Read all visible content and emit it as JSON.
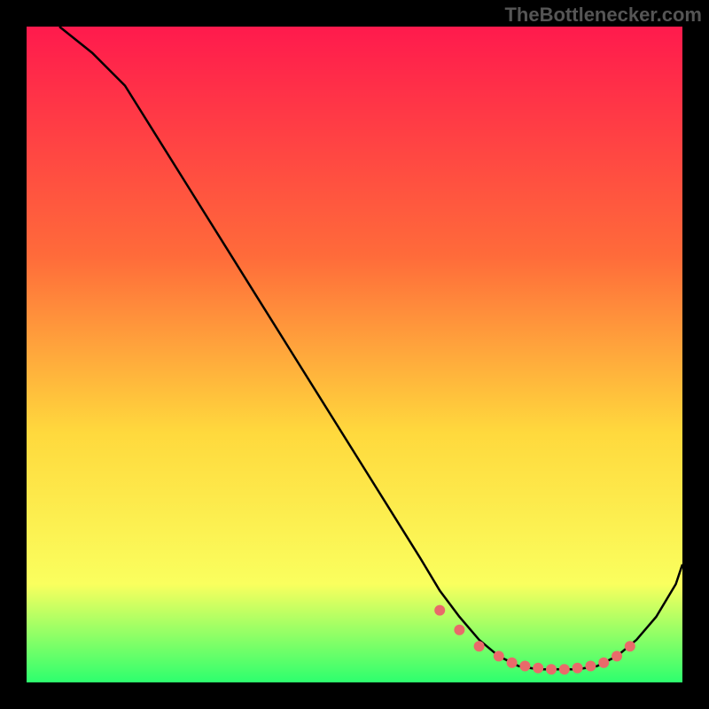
{
  "attribution": "TheBottlenecker.com",
  "chart_data": {
    "type": "line",
    "title": "",
    "xlabel": "",
    "ylabel": "",
    "xlim": [
      0,
      100
    ],
    "ylim": [
      0,
      100
    ],
    "gradient": {
      "top": "#ff1a4d",
      "mid_upper": "#ff6b3a",
      "mid": "#ffd93d",
      "mid_lower": "#faff5e",
      "bottom": "#2dff6e"
    },
    "series": [
      {
        "name": "curve",
        "x": [
          5,
          10,
          15,
          20,
          25,
          30,
          35,
          40,
          45,
          50,
          55,
          60,
          63,
          66,
          69,
          72,
          75,
          78,
          81,
          84,
          87,
          90,
          93,
          96,
          99,
          100
        ],
        "y": [
          100,
          96,
          91,
          83,
          75,
          67,
          59,
          51,
          43,
          35,
          27,
          19,
          14,
          10,
          6.5,
          4,
          2.5,
          2,
          2,
          2,
          2.5,
          4,
          6.5,
          10,
          15,
          18
        ]
      }
    ],
    "markers": {
      "name": "dotted-green-band",
      "x": [
        63,
        66,
        69,
        72,
        74,
        76,
        78,
        80,
        82,
        84,
        86,
        88,
        90,
        92
      ],
      "y": [
        11,
        8,
        5.5,
        4,
        3,
        2.5,
        2.2,
        2,
        2,
        2.2,
        2.5,
        3,
        4,
        5.5
      ]
    }
  }
}
